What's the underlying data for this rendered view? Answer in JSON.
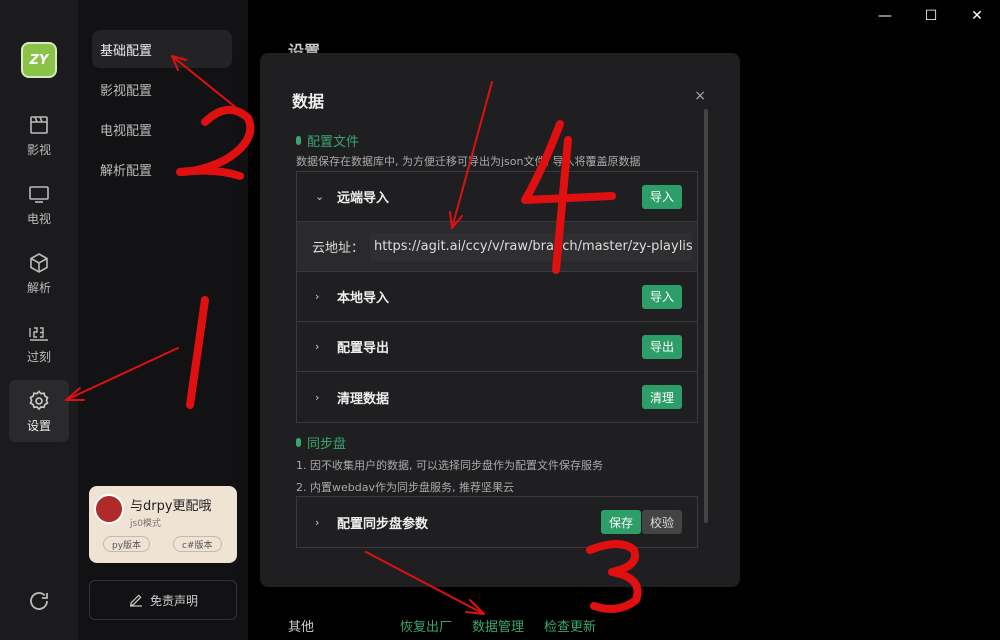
{
  "window": {
    "minimize": "—",
    "maximize": "☐",
    "close": "✕"
  },
  "logo": {
    "text": "ZY",
    "color": "#8bc34a"
  },
  "rail": [
    {
      "label": "影视",
      "icon": "film-icon"
    },
    {
      "label": "电视",
      "icon": "tv-icon"
    },
    {
      "label": "解析",
      "icon": "cube-icon"
    },
    {
      "label": "过刻",
      "icon": "numbers-icon"
    },
    {
      "label": "设置",
      "icon": "gear-icon"
    }
  ],
  "subnav": [
    "基础配置",
    "影视配置",
    "电视配置",
    "解析配置"
  ],
  "promo": {
    "title": "与drpy更配哦",
    "subtitle": "js0模式",
    "tag_py": "py版本",
    "tag_cs": "c#版本"
  },
  "disclaimer": "免责声明",
  "page": {
    "title": "设置",
    "footer_label": "其他",
    "footer_links": [
      "恢复出厂",
      "数据管理",
      "检查更新"
    ]
  },
  "modal": {
    "title": "数据",
    "close": "×",
    "config_section": {
      "heading": "配置文件",
      "description": "数据保存在数据库中, 为方便迁移可导出为json文件, 导入将覆盖原数据",
      "rows": [
        {
          "label": "远端导入",
          "button": "导入",
          "expanded": true,
          "chevron": "⌄"
        },
        {
          "label": "本地导入",
          "button": "导入",
          "chevron": "›"
        },
        {
          "label": "配置导出",
          "button": "导出",
          "chevron": "›"
        },
        {
          "label": "清理数据",
          "button": "清理",
          "chevron": "›"
        }
      ],
      "url_label": "云地址：",
      "url_value": "https://agit.ai/ccy/v/raw/branch/master/zy-playlist.json"
    },
    "sync_section": {
      "heading": "同步盘",
      "desc1": "1. 因不收集用户的数据, 可以选择同步盘作为配置文件保存服务",
      "desc2": "2. 内置webdav作为同步盘服务, 推荐坚果云",
      "row_label": "配置同步盘参数",
      "row_chevron": "›",
      "save": "保存",
      "verify": "校验"
    }
  },
  "accent_color": "#2e9e68",
  "annotation_color": "#e01010"
}
